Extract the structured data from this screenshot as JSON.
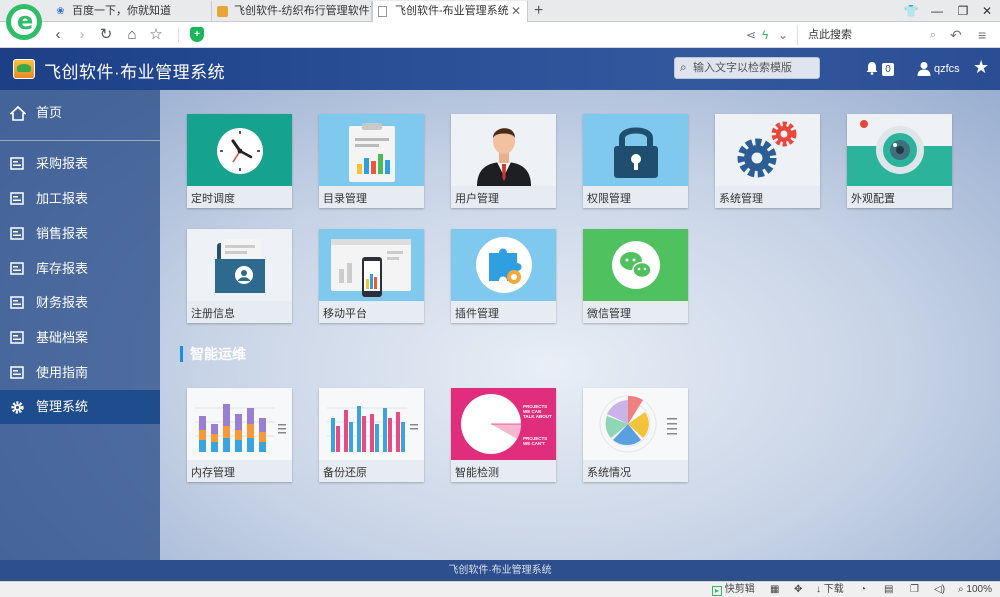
{
  "browser": {
    "tabs": [
      {
        "title": "百度一下，你就知道",
        "icon": "paw-icon"
      },
      {
        "title": "飞创软件-纺织布行管理软件首选",
        "icon": "favicon-icon"
      },
      {
        "title": "飞创软件-布业管理系统",
        "icon": "page-icon"
      }
    ],
    "search_placeholder": "点此搜索",
    "status": {
      "screenshot_label": "快剪辑",
      "download_label": "下载",
      "zoom": "100%"
    }
  },
  "app": {
    "title": "飞创软件·布业管理系统",
    "search_placeholder": "输入文字以检索模版",
    "notification_count": "0",
    "username": "qzfcs",
    "footer": "飞创软件·布业管理系统",
    "accent_color": "#1b8fd7"
  },
  "sidebar": {
    "items": [
      {
        "label": "首页",
        "icon": "home-icon"
      },
      {
        "label": "采购报表",
        "icon": "report-icon"
      },
      {
        "label": "加工报表",
        "icon": "report-icon"
      },
      {
        "label": "销售报表",
        "icon": "report-icon"
      },
      {
        "label": "库存报表",
        "icon": "report-icon"
      },
      {
        "label": "财务报表",
        "icon": "report-icon"
      },
      {
        "label": "基础档案",
        "icon": "report-icon"
      },
      {
        "label": "使用指南",
        "icon": "report-icon"
      },
      {
        "label": "管理系统",
        "icon": "gear-icon",
        "active": true
      }
    ]
  },
  "tiles_main": [
    {
      "label": "定时调度",
      "icon": "clock-icon"
    },
    {
      "label": "目录管理",
      "icon": "clipboard-chart-icon"
    },
    {
      "label": "用户管理",
      "icon": "businessman-icon"
    },
    {
      "label": "权限管理",
      "icon": "padlock-icon"
    },
    {
      "label": "系统管理",
      "icon": "gears-icon"
    },
    {
      "label": "外观配置",
      "icon": "camera-lens-icon"
    },
    {
      "label": "注册信息",
      "icon": "id-folder-icon"
    },
    {
      "label": "移动平台",
      "icon": "mobile-screen-icon"
    },
    {
      "label": "插件管理",
      "icon": "puzzle-icon"
    },
    {
      "label": "微信管理",
      "icon": "wechat-icon"
    }
  ],
  "section": {
    "title": "智能运维"
  },
  "tiles_ops": [
    {
      "label": "内存管理",
      "icon": "stacked-bar-icon"
    },
    {
      "label": "备份还原",
      "icon": "bar-chart-icon"
    },
    {
      "label": "智能检测",
      "icon": "pie-projects-icon",
      "text_a": "PROJECTS WE CAN TALK ABOUT",
      "text_b": "PROJECTS WE CAN'T"
    },
    {
      "label": "系统情况",
      "icon": "radial-chart-icon"
    }
  ]
}
